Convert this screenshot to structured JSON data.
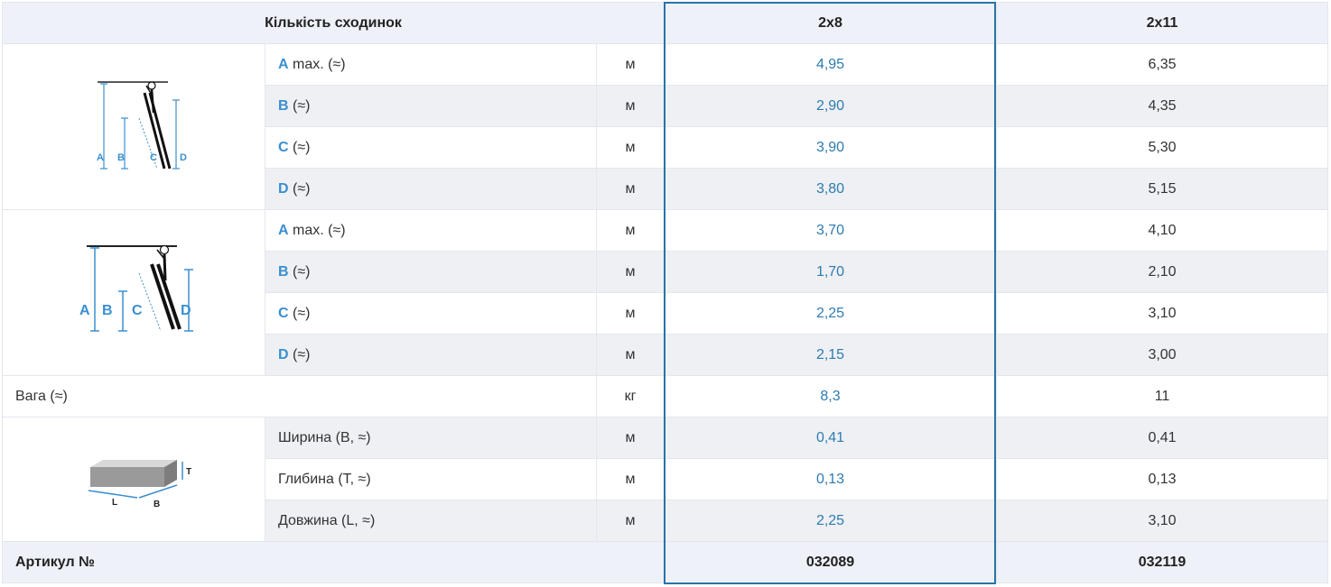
{
  "header": {
    "title": "Кількість сходинок",
    "models": [
      "2x8",
      "2x11"
    ]
  },
  "config1": {
    "figure_labels": [
      "A",
      "B",
      "C",
      "D"
    ],
    "rows": [
      {
        "letter": "A",
        "suffix": " max. (≈)",
        "unit": "м",
        "v1": "4,95",
        "v2": "6,35"
      },
      {
        "letter": "B",
        "suffix": " (≈)",
        "unit": "м",
        "v1": "2,90",
        "v2": "4,35"
      },
      {
        "letter": "C",
        "suffix": " (≈)",
        "unit": "м",
        "v1": "3,90",
        "v2": "5,30"
      },
      {
        "letter": "D",
        "suffix": " (≈)",
        "unit": "м",
        "v1": "3,80",
        "v2": "5,15"
      }
    ]
  },
  "config2": {
    "figure_labels": [
      "A",
      "B",
      "C",
      "D"
    ],
    "rows": [
      {
        "letter": "A",
        "suffix": " max. (≈)",
        "unit": "м",
        "v1": "3,70",
        "v2": "4,10"
      },
      {
        "letter": "B",
        "suffix": " (≈)",
        "unit": "м",
        "v1": "1,70",
        "v2": "2,10"
      },
      {
        "letter": "C",
        "suffix": " (≈)",
        "unit": "м",
        "v1": "2,25",
        "v2": "3,10"
      },
      {
        "letter": "D",
        "suffix": " (≈)",
        "unit": "м",
        "v1": "2,15",
        "v2": "3,00"
      }
    ]
  },
  "weight": {
    "label": "Вага (≈)",
    "unit": "кг",
    "v1": "8,3",
    "v2": "11"
  },
  "package": {
    "figure_labels": [
      "T",
      "L",
      "B"
    ],
    "rows": [
      {
        "label": "Ширина (B, ≈)",
        "unit": "м",
        "v1": "0,41",
        "v2": "0,41"
      },
      {
        "label": "Глибина (T, ≈)",
        "unit": "м",
        "v1": "0,13",
        "v2": "0,13"
      },
      {
        "label": "Довжина (L, ≈)",
        "unit": "м",
        "v1": "2,25",
        "v2": "3,10"
      }
    ]
  },
  "article": {
    "label": "Артикул №",
    "v1": "032089",
    "v2": "032119"
  },
  "colors": {
    "accent": "#2a73a8",
    "letter": "#3a8fd0",
    "row_alt": "#eef0f4",
    "header_bg": "#eef1f8"
  }
}
